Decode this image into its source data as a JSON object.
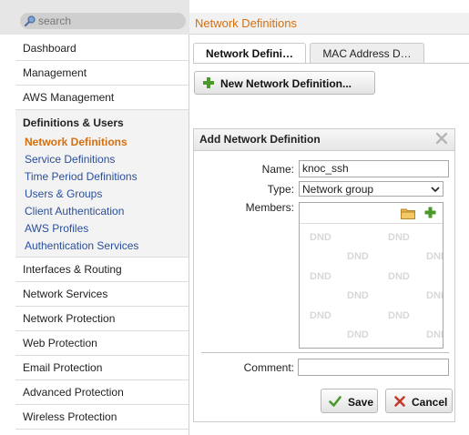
{
  "search": {
    "placeholder": "search"
  },
  "sidebar": {
    "items_top": [
      {
        "label": "Dashboard"
      },
      {
        "label": "Management"
      },
      {
        "label": "AWS Management"
      }
    ],
    "section": {
      "title": "Definitions & Users",
      "items": [
        {
          "label": "Network Definitions",
          "active": true
        },
        {
          "label": "Service Definitions"
        },
        {
          "label": "Time Period Definitions"
        },
        {
          "label": "Users & Groups"
        },
        {
          "label": "Client Authentication"
        },
        {
          "label": "AWS Profiles"
        },
        {
          "label": "Authentication Services"
        }
      ]
    },
    "items_bottom": [
      {
        "label": "Interfaces & Routing"
      },
      {
        "label": "Network Services"
      },
      {
        "label": "Network Protection"
      },
      {
        "label": "Web Protection"
      },
      {
        "label": "Email Protection"
      },
      {
        "label": "Advanced Protection"
      },
      {
        "label": "Wireless Protection"
      }
    ]
  },
  "header": {
    "title": "Network Definitions"
  },
  "tabs": [
    {
      "label": "Network Defini…"
    },
    {
      "label": "MAC Address D…"
    }
  ],
  "toolbar": {
    "new_label": "New Network Definition..."
  },
  "dialog": {
    "title": "Add Network Definition",
    "name_label": "Name:",
    "name_value": "knoc_ssh",
    "type_label": "Type:",
    "type_value": "Network group",
    "members_label": "Members:",
    "members_watermark": "DND",
    "comment_label": "Comment:",
    "comment_value": "",
    "save_label": "Save",
    "cancel_label": "Cancel"
  },
  "colors": {
    "accent_orange": "#d46f0f",
    "link_blue": "#2b4f9c",
    "add_green": "#4a9a2a",
    "cancel_red": "#c0392b"
  }
}
